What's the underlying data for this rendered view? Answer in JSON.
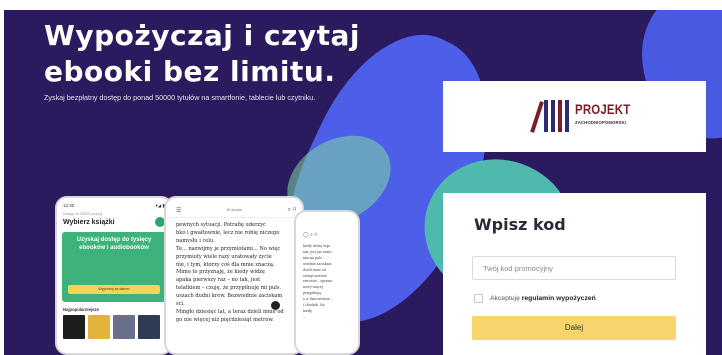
{
  "hero": {
    "headline_line1": "Wypożyczaj i czytaj",
    "headline_line2": "ebooki bez limitu.",
    "subline": "Zyskaj bezpłatny dostęp do ponad 50000 tytułów na smartfonie, tablecie lub czytniku."
  },
  "phone_store": {
    "status_time": "12:30",
    "status_icons": "▾◢ ▮",
    "small_caption": "Dostęp do 50000 pozycji",
    "title": "Wybierz książki",
    "banner_text": "Uzyskaj dostęp do tysięcy ebooków i audiobooków",
    "banner_button": "Wypróbuj za darmo",
    "section_title": "Najpopularniejsze",
    "cover_colors": [
      "#1d1d1d",
      "#e2b23a",
      "#6b6e8a",
      "#2f3b52"
    ]
  },
  "phone_reader": {
    "menu_icon": "☰",
    "center_label": "W drodze",
    "search_icon": "⌕",
    "bookmark_icon": "⌑",
    "lines": [
      "pewnych sytuacji. Potrafię uderzyć",
      "bko i gwałtownie, lecz nie robię niczego",
      " namysłu i celu.",
      "Te... nazwijmy je przymiotami... No więc",
      "przymioty wiele razy uratowały życie",
      "nie, i tym, którzy coś dla mnie znaczą.",
      "Mimo to przyznaję, że kiedy widzę",
      "apaka pierwszy raz – no tak, jest",
      "tolatkiem – czuję, że przypilnuję mi puls.",
      "uszach dudni krew. Bezwiednie zaciskam",
      "ści.",
      "Mingło dziesięć lat, a teraz dzieli mnie od",
      "go nie więcej niż pięćdziesiąt metrów."
    ]
  },
  "phone_tablet": {
    "icons": "◯  ⌕  ⌑",
    "lines": [
      "kiedy widzę tego",
      "tak, jest już nasto-",
      "mia mi puls.",
      "wiednie zaciskam",
      "",
      "dzieli mnie od",
      "ziesiąt metrów.",
      "zwrotów – sprawa",
      "nowy więcej",
      "przypilnuję",
      "a w dzieciństwie...",
      "i chodnik. Na",
      "kiedy,",
      "..."
    ]
  },
  "logo": {
    "name": "PROJEKT",
    "subtitle": "ZACHODNIOPOMORSKI",
    "bar_colors": [
      "#7a1f25",
      "#2d2d6e",
      "#2d2d6e",
      "#7a1f25",
      "#2d2d6e"
    ]
  },
  "form": {
    "title": "Wpisz kod",
    "code_placeholder": "Twój kod promocyjny",
    "terms_prefix": "Akceptuję ",
    "terms_link": "regulamin wypożyczeń",
    "terms_suffix": ".",
    "submit_label": "Dalej"
  },
  "colors": {
    "background": "#2b1b5e",
    "accent_button": "#f7d56b",
    "brand_red": "#7a1f25",
    "brand_navy": "#2d2d6e"
  }
}
